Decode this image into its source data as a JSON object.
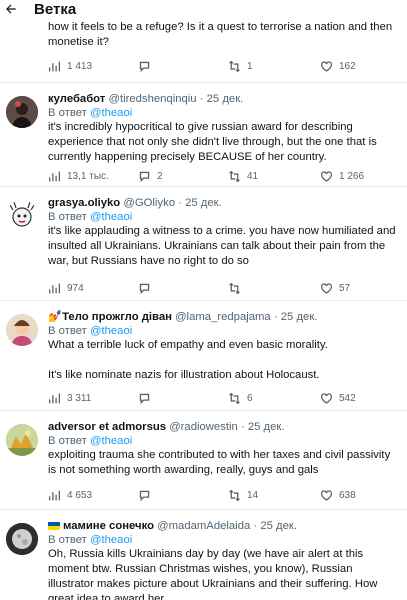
{
  "header": {
    "title": "Ветка"
  },
  "cut_tweet": {
    "text": "how it feels to be a refuge? Is it a quest to terrorise a nation and then monetise it?",
    "replies": "1 413",
    "retweets": "1",
    "likes": "162"
  },
  "tweets": [
    {
      "name": "кулебабот",
      "handle": "@tiredshenqinqiu",
      "time": "25 дек.",
      "reply_prefix": "В ответ",
      "reply_to": "@theaoi",
      "paragraphs": [
        "it's incredibly hypocritical to give russian award for describing experience that not only she didn't live through, but the one that is currently happening precisely BECAUSE of her country."
      ],
      "views": "13,1 тыс.",
      "replies": "2",
      "retweets": "41",
      "likes": "1 266"
    },
    {
      "name": "grasya.oliyko",
      "handle": "@GOliyko",
      "time": "25 дек.",
      "reply_prefix": "В ответ",
      "reply_to": "@theaoi",
      "paragraphs": [
        "it's like applauding a witness to a crime.  you have now humiliated and insulted all Ukrainians.  Ukrainians can talk about their pain from the war, but Russians have no right to do so"
      ],
      "views": "974",
      "replies": "",
      "retweets": "",
      "likes": "57"
    },
    {
      "name": "Тело прожгло діван",
      "name_emoji": "💅",
      "handle": "@lama_redpajama",
      "time": "25 дек.",
      "reply_prefix": "В ответ",
      "reply_to": "@theaoi",
      "paragraphs": [
        "What a terrible luck of empathy and even basic morality.",
        "It's like nominate nazis for illustration about Holocaust."
      ],
      "views": "3 311",
      "replies": "",
      "retweets": "6",
      "likes": "542"
    },
    {
      "name": "adversor et admorsus",
      "handle": "@radiowestin",
      "time": "25 дек.",
      "reply_prefix": "В ответ",
      "reply_to": "@theaoi",
      "paragraphs": [
        "exploiting trauma she contributed to with her taxes and civil passivity is not something worth awarding, really, guys and gals"
      ],
      "views": "4 653",
      "replies": "",
      "retweets": "14",
      "likes": "638"
    },
    {
      "name": "мамине сонечко",
      "name_flag": "ukraine-flag",
      "handle": "@madamAdelaida",
      "time": "25 дек.",
      "reply_prefix": "В ответ",
      "reply_to": "@theaoi",
      "paragraphs": [
        "Oh, Russia kills Ukrainians day by day (we have air alert at this moment btw. Russian Christmas wishes, you know), Russian illustrator makes picture about Ukrainians and their suffering. How great idea to award her."
      ]
    }
  ],
  "colors": {
    "accent": "#1d9bf0",
    "secondary_text": "#536471",
    "divider": "#e6ecf0"
  }
}
